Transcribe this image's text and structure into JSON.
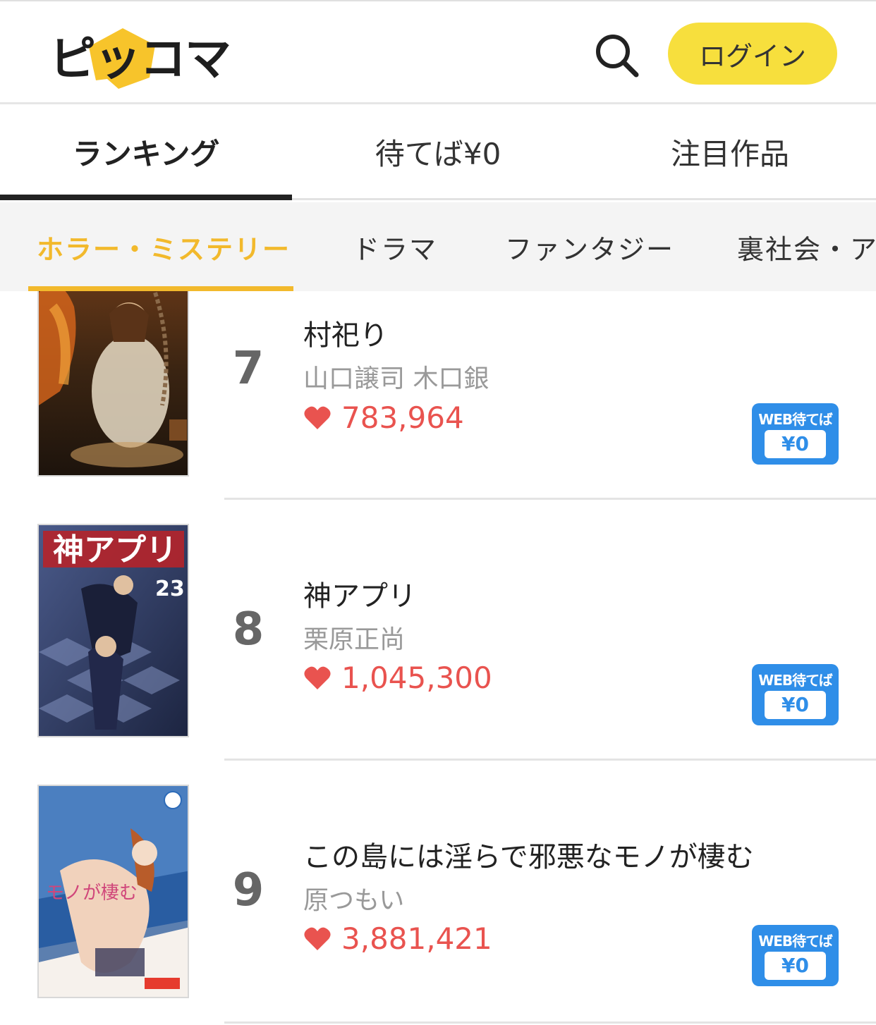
{
  "header": {
    "logo_text": "ピッコマ",
    "login_label": "ログイン"
  },
  "main_tabs": [
    {
      "label": "ランキング",
      "active": true
    },
    {
      "label": "待てば¥0",
      "active": false
    },
    {
      "label": "注目作品",
      "active": false
    }
  ],
  "genre_tabs": [
    {
      "label": "ホラー・ミステリー",
      "active": true
    },
    {
      "label": "ドラマ",
      "active": false
    },
    {
      "label": "ファンタジー",
      "active": false
    },
    {
      "label": "裏社会・ア",
      "active": false
    }
  ],
  "items": [
    {
      "rank": "7",
      "title": "村祀り",
      "author": "山口譲司 木口銀",
      "likes": "783,964",
      "badge_top": "WEB待てば",
      "badge_price": "¥0"
    },
    {
      "rank": "8",
      "title": "神アプリ",
      "author": "栗原正尚",
      "likes": "1,045,300",
      "badge_top": "WEB待てば",
      "badge_price": "¥0"
    },
    {
      "rank": "9",
      "title": "この島には淫らで邪悪なモノが棲む",
      "author": "原つもい",
      "likes": "3,881,421",
      "badge_top": "WEB待てば",
      "badge_price": "¥0"
    }
  ],
  "colors": {
    "accent_yellow": "#f7df3d",
    "genre_active": "#f2b92c",
    "likes_red": "#e9534f",
    "badge_blue": "#2f8ee8"
  },
  "icons": [
    "search-icon",
    "heart-icon"
  ]
}
